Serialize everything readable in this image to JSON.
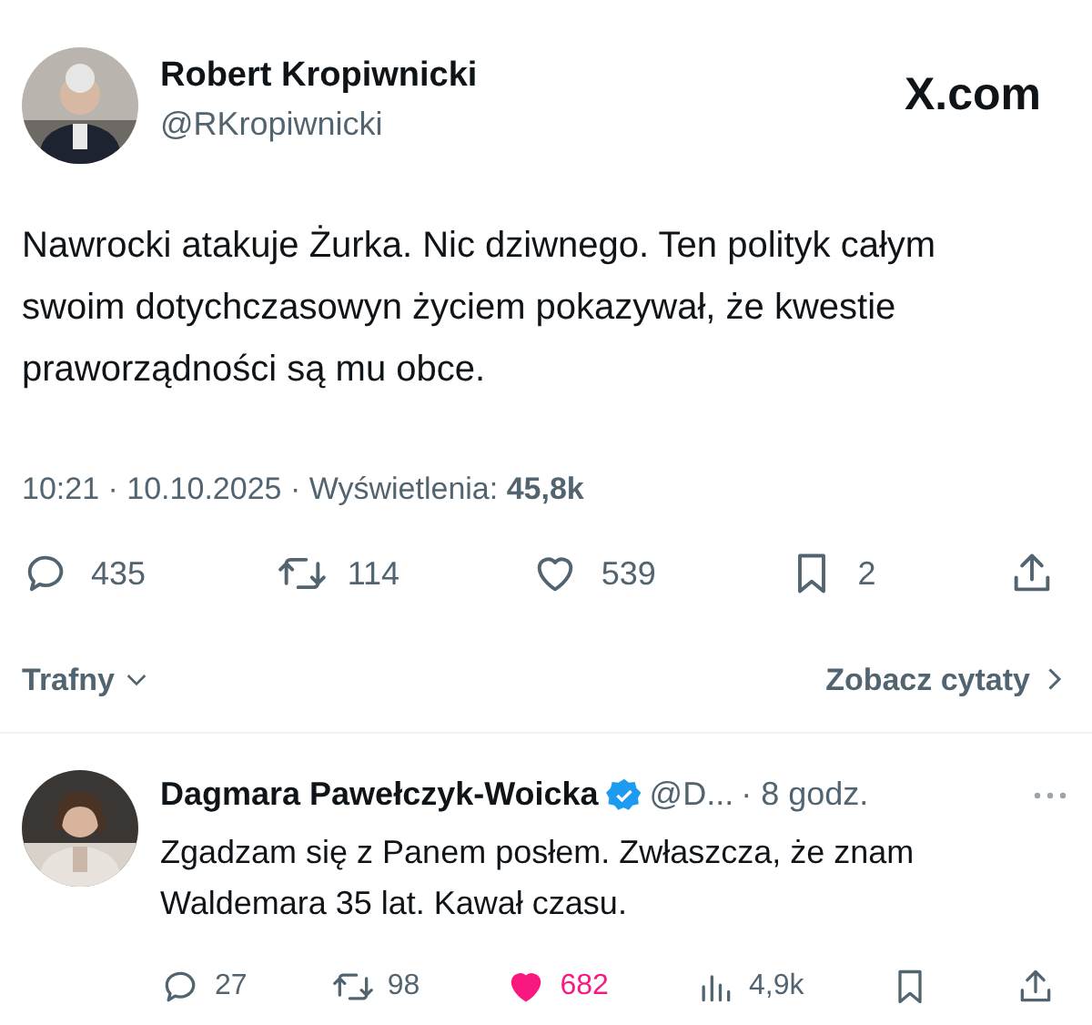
{
  "tweet": {
    "author": {
      "name": "Robert Kropiwnicki",
      "handle": "@RKropiwnicki"
    },
    "site": "X.com",
    "text": "Nawrocki atakuje Żurka. Nic dziwnego. Ten polityk całym swoim dotychczasowyn życiem pokazywał, że kwestie praworządności są mu obce.",
    "meta": "10:21 · 10.10.2025 · Wyświetlenia: **45,8k**",
    "actions": [
      {
        "kind": "reply",
        "count": "435",
        "active": false
      },
      {
        "kind": "repost",
        "count": "114",
        "active": false
      },
      {
        "kind": "like",
        "count": "539",
        "active": false
      },
      {
        "kind": "bookmark",
        "count": "2",
        "active": false
      },
      {
        "kind": "share",
        "active": false
      }
    ]
  },
  "sort": {
    "label": "Trafny"
  },
  "quotes_link": {
    "label": "Zobacz cytaty"
  },
  "replies": [
    {
      "author": {
        "name": "Dagmara Pawełczyk-Woicka",
        "verified": true,
        "handle": "@D..."
      },
      "time": "· 8 godz.",
      "text": "Zgadzam się z Panem posłem. Zwłaszcza, że znam Waldemara 35 lat. Kawał czasu.",
      "actions": [
        {
          "kind": "reply",
          "count": "27",
          "active": false
        },
        {
          "kind": "repost",
          "count": "98",
          "active": false
        },
        {
          "kind": "like",
          "count": "682",
          "active": true
        },
        {
          "kind": "views",
          "count": "4,9k",
          "active": false
        },
        {
          "kind": "bookmark",
          "active": false
        },
        {
          "kind": "share",
          "active": false
        }
      ]
    }
  ]
}
